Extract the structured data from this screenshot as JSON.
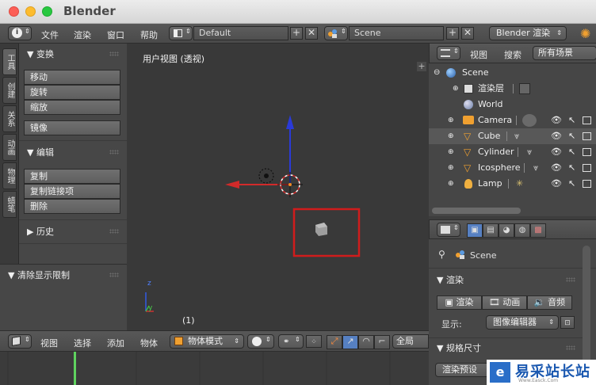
{
  "window": {
    "title": "Blender"
  },
  "info_header": {
    "menus": [
      "文件",
      "渲染",
      "窗口",
      "帮助"
    ],
    "screen_layout": "Default",
    "scene": "Scene",
    "render_engine": "Blender 渲染"
  },
  "tool_shelf": {
    "tabs": [
      "工具",
      "创建",
      "关系",
      "动画",
      "物理",
      "蜡笔"
    ],
    "transform": {
      "title": "▼ 变换",
      "buttons": [
        "移动",
        "旋转",
        "缩放"
      ],
      "mirror": "镜像"
    },
    "edit": {
      "title": "▼ 编辑",
      "buttons": [
        "复制",
        "复制链接项",
        "删除"
      ]
    },
    "history": {
      "title": "▶ 历史"
    },
    "clear_limit": {
      "title": "▼ 清除显示限制"
    }
  },
  "viewport": {
    "label": "用户视图 (透视)",
    "frame": "(1)",
    "axis_z": "z",
    "axis_y": "y"
  },
  "view3d_header": {
    "menus": [
      "视图",
      "选择",
      "添加",
      "物体"
    ],
    "mode": "物体模式",
    "orientation": "全局"
  },
  "outliner": {
    "menus": [
      "视图",
      "搜索"
    ],
    "filter": "所有场景",
    "rows": [
      {
        "name": "Scene"
      },
      {
        "name": "渲染层"
      },
      {
        "name": "World"
      },
      {
        "name": "Camera"
      },
      {
        "name": "Cube"
      },
      {
        "name": "Cylinder"
      },
      {
        "name": "Icosphere"
      },
      {
        "name": "Lamp"
      }
    ]
  },
  "properties": {
    "context": "Scene",
    "render_panel": "▼ 渲染",
    "render_buttons": [
      "渲染",
      "动画",
      "音频"
    ],
    "display_label": "显示:",
    "display_value": "图像编辑器",
    "dimensions_panel": "▼ 规格尺寸",
    "render_preset": "渲染预设"
  },
  "watermark": {
    "text": "易采站长站",
    "sub": "Www.Easck.Com"
  },
  "colors": {
    "selection_box": "#d01c1c",
    "axis_x": "#e03030",
    "axis_y": "#3060ff",
    "frame_marker": "#5fd35f"
  }
}
